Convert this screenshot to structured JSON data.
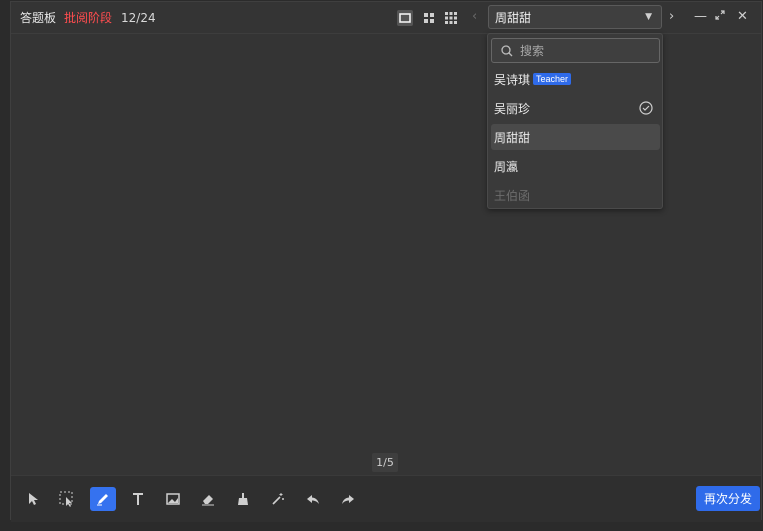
{
  "header": {
    "title": "答题板",
    "stage": "批阅阶段",
    "progress": "12/24"
  },
  "student_select": {
    "selected": "周甜甜"
  },
  "dropdown": {
    "search_placeholder": "搜索",
    "options": [
      {
        "name": "吴诗琪",
        "tag": "Teacher"
      },
      {
        "name": "吴丽珍",
        "checked": true
      },
      {
        "name": "周甜甜",
        "selected": true
      },
      {
        "name": "周瀛"
      },
      {
        "name": "王伯函",
        "disabled": true
      }
    ]
  },
  "canvas": {
    "page_indicator": "1/5"
  },
  "toolbar": {
    "tools": [
      "pointer-icon",
      "marquee-select-icon",
      "pen-icon",
      "text-icon",
      "image-icon",
      "eraser-icon",
      "clear-brush-icon",
      "magic-wand-icon",
      "undo-icon",
      "redo-icon"
    ],
    "active_tool": "pen-icon",
    "redistribute_label": "再次分发"
  },
  "colors": {
    "accent": "#2f6bea",
    "stage_red": "#ff4d4f",
    "panel_bg": "#343434"
  }
}
